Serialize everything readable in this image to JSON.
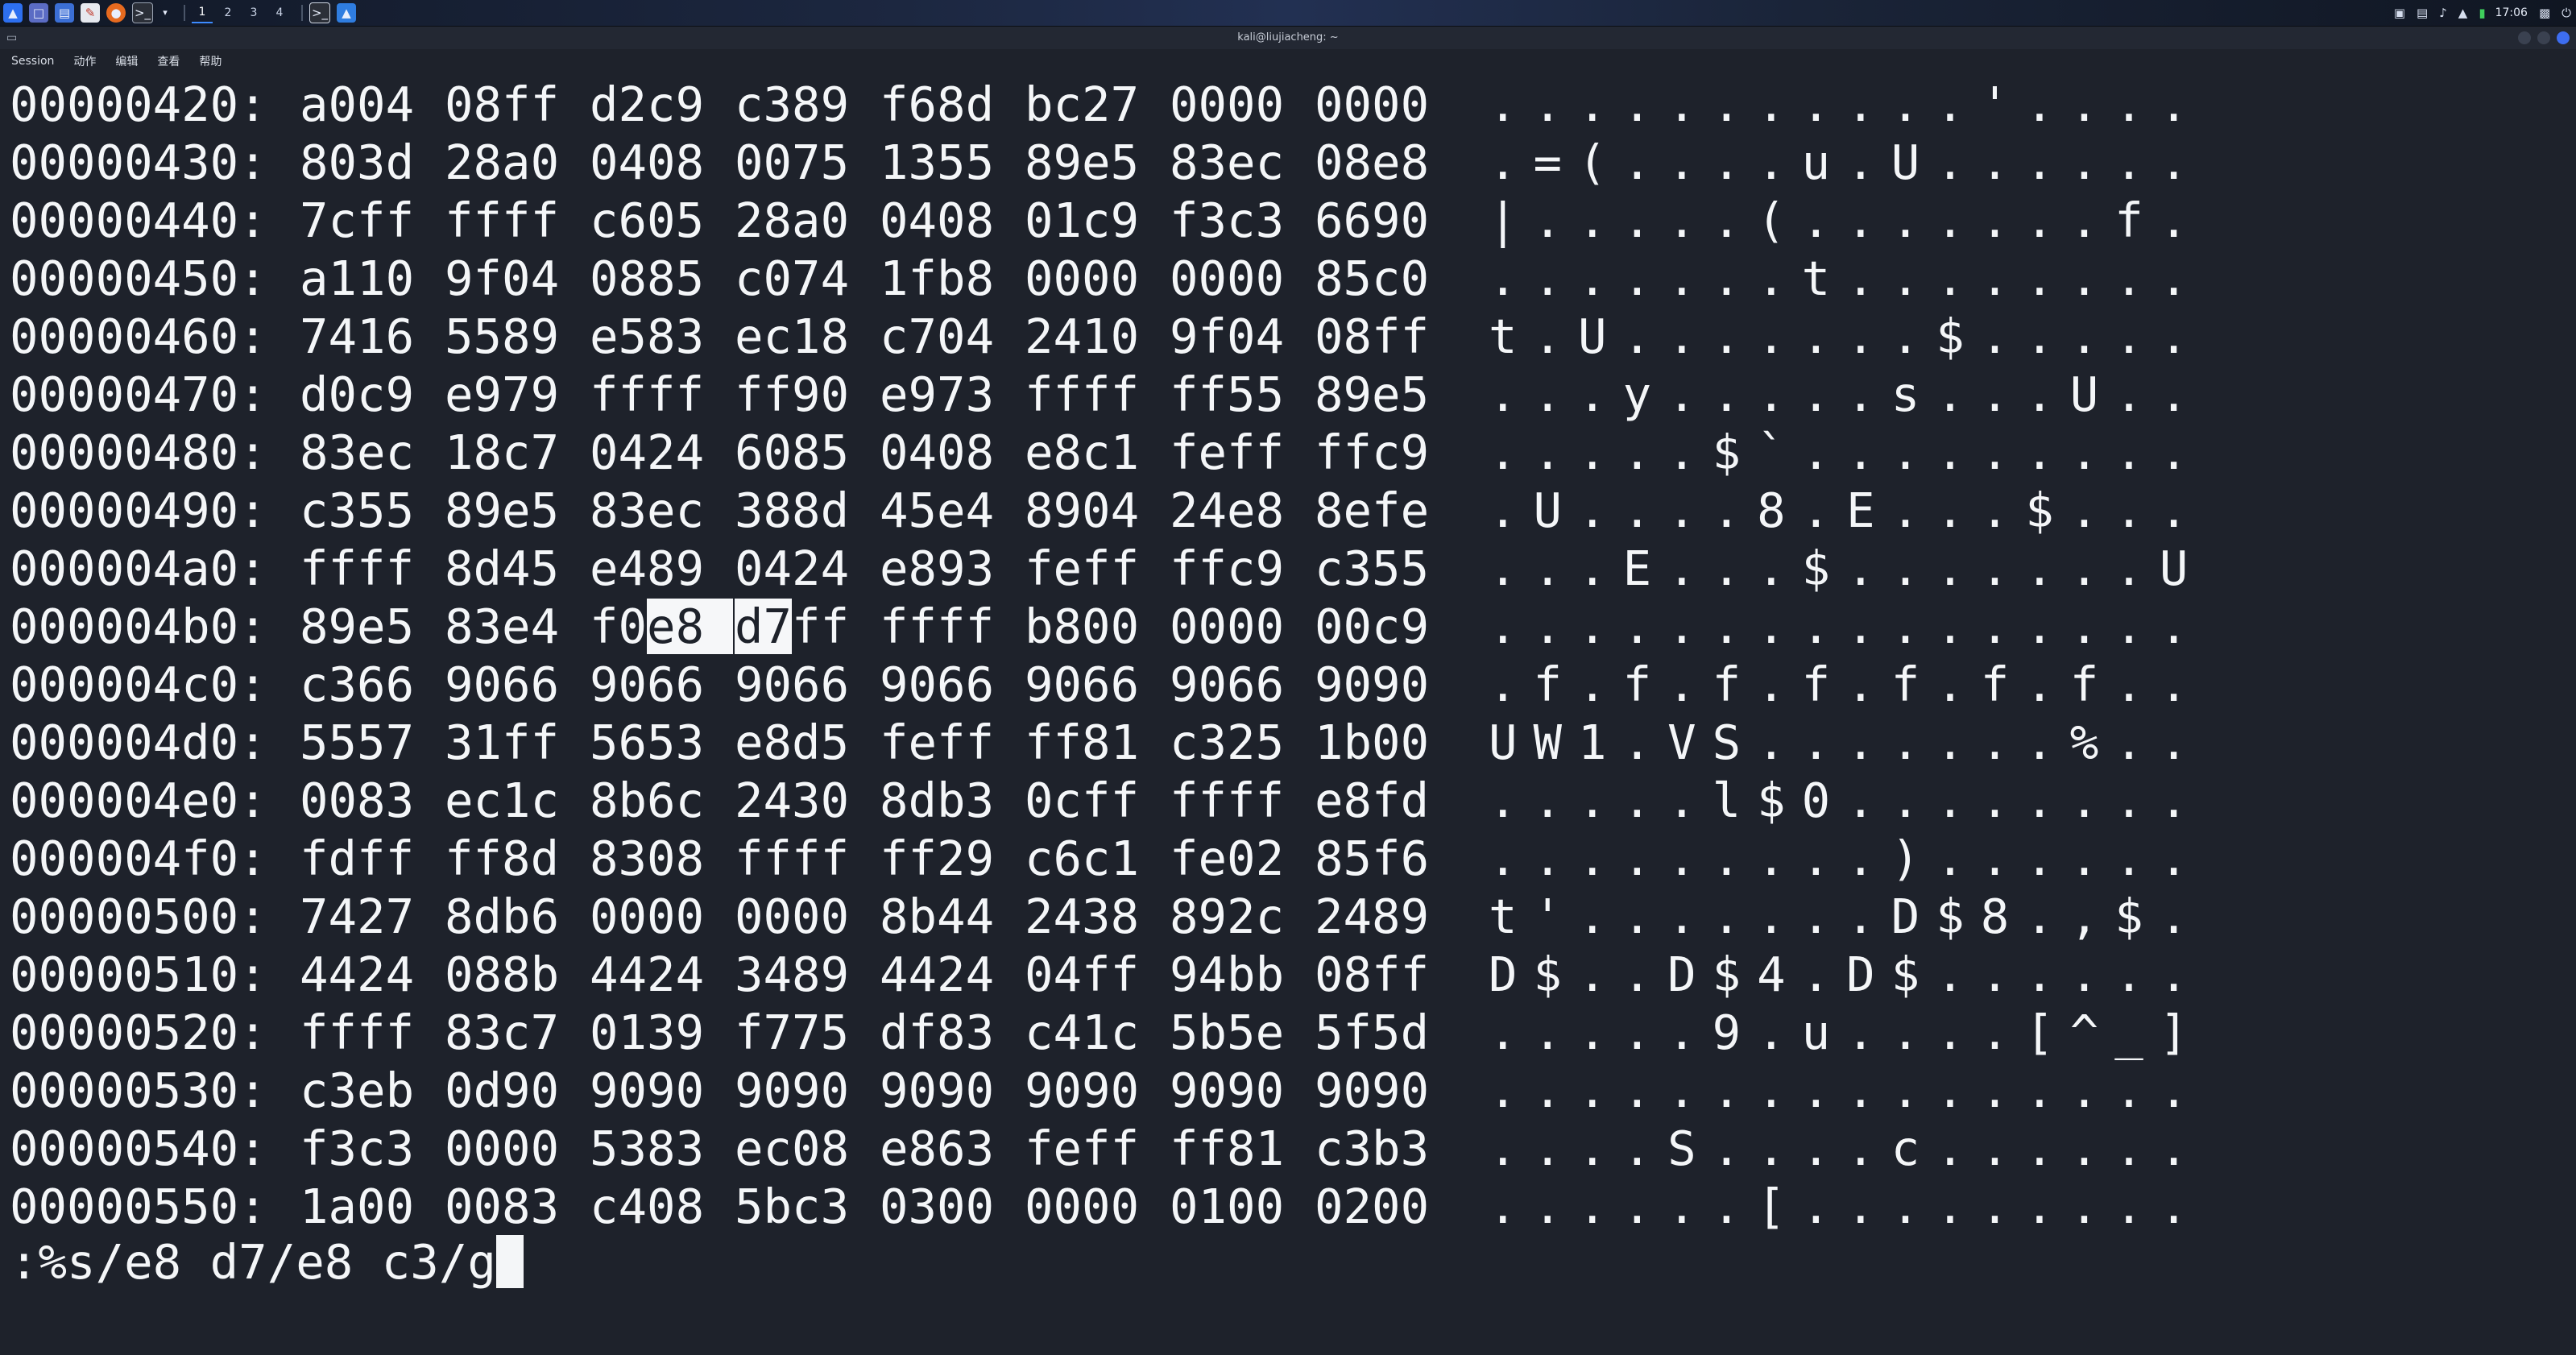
{
  "taskbar": {
    "workspaces": [
      "1",
      "2",
      "3",
      "4"
    ],
    "active_workspace": "1",
    "clock": "17:06",
    "accent": "#3d8bff"
  },
  "window": {
    "title": "kali@liujiacheng: ~"
  },
  "menu": {
    "items": [
      "Session",
      "动作",
      "编辑",
      "查看",
      "帮助"
    ]
  },
  "hexdump": {
    "rows": [
      {
        "addr": "00000420:",
        "groups": [
          "a004",
          "08ff",
          "d2c9",
          "c389",
          "f68d",
          "bc27",
          "0000",
          "0000"
        ],
        "ascii": "...........'...."
      },
      {
        "addr": "00000430:",
        "groups": [
          "803d",
          "28a0",
          "0408",
          "0075",
          "1355",
          "89e5",
          "83ec",
          "08e8"
        ],
        "ascii": ".=(....u.U......"
      },
      {
        "addr": "00000440:",
        "groups": [
          "7cff",
          "ffff",
          "c605",
          "28a0",
          "0408",
          "01c9",
          "f3c3",
          "6690"
        ],
        "ascii": "|.....(.......f."
      },
      {
        "addr": "00000450:",
        "groups": [
          "a110",
          "9f04",
          "0885",
          "c074",
          "1fb8",
          "0000",
          "0000",
          "85c0"
        ],
        "ascii": ".......t........"
      },
      {
        "addr": "00000460:",
        "groups": [
          "7416",
          "5589",
          "e583",
          "ec18",
          "c704",
          "2410",
          "9f04",
          "08ff"
        ],
        "ascii": "t.U.......$....."
      },
      {
        "addr": "00000470:",
        "groups": [
          "d0c9",
          "e979",
          "ffff",
          "ff90",
          "e973",
          "ffff",
          "ff55",
          "89e5"
        ],
        "ascii": "...y.....s...U.."
      },
      {
        "addr": "00000480:",
        "groups": [
          "83ec",
          "18c7",
          "0424",
          "6085",
          "0408",
          "e8c1",
          "feff",
          "ffc9"
        ],
        "ascii": ".....$`........."
      },
      {
        "addr": "00000490:",
        "groups": [
          "c355",
          "89e5",
          "83ec",
          "388d",
          "45e4",
          "8904",
          "24e8",
          "8efe"
        ],
        "ascii": ".U....8.E...$..."
      },
      {
        "addr": "000004a0:",
        "groups": [
          "ffff",
          "8d45",
          "e489",
          "0424",
          "e893",
          "feff",
          "ffc9",
          "c355"
        ],
        "ascii": "...E...$.......U"
      },
      {
        "addr": "000004b0:",
        "groups": [
          "89e5",
          "83e4",
          "f0e8",
          "d7ff",
          "ffff",
          "b800",
          "0000",
          "00c9"
        ],
        "ascii": "................"
      },
      {
        "addr": "000004c0:",
        "groups": [
          "c366",
          "9066",
          "9066",
          "9066",
          "9066",
          "9066",
          "9066",
          "9090"
        ],
        "ascii": ".f.f.f.f.f.f.f.."
      },
      {
        "addr": "000004d0:",
        "groups": [
          "5557",
          "31ff",
          "5653",
          "e8d5",
          "feff",
          "ff81",
          "c325",
          "1b00"
        ],
        "ascii": "UW1.VS.......%.."
      },
      {
        "addr": "000004e0:",
        "groups": [
          "0083",
          "ec1c",
          "8b6c",
          "2430",
          "8db3",
          "0cff",
          "ffff",
          "e8fd"
        ],
        "ascii": ".....l$0........"
      },
      {
        "addr": "000004f0:",
        "groups": [
          "fdff",
          "ff8d",
          "8308",
          "ffff",
          "ff29",
          "c6c1",
          "fe02",
          "85f6"
        ],
        "ascii": ".........)......"
      },
      {
        "addr": "00000500:",
        "groups": [
          "7427",
          "8db6",
          "0000",
          "0000",
          "8b44",
          "2438",
          "892c",
          "2489"
        ],
        "ascii": "t'.......D$8.,$."
      },
      {
        "addr": "00000510:",
        "groups": [
          "4424",
          "088b",
          "4424",
          "3489",
          "4424",
          "04ff",
          "94bb",
          "08ff"
        ],
        "ascii": "D$..D$4.D$......"
      },
      {
        "addr": "00000520:",
        "groups": [
          "ffff",
          "83c7",
          "0139",
          "f775",
          "df83",
          "c41c",
          "5b5e",
          "5f5d"
        ],
        "ascii": ".....9.u....[^_]"
      },
      {
        "addr": "00000530:",
        "groups": [
          "c3eb",
          "0d90",
          "9090",
          "9090",
          "9090",
          "9090",
          "9090",
          "9090"
        ],
        "ascii": "................"
      },
      {
        "addr": "00000540:",
        "groups": [
          "f3c3",
          "0000",
          "5383",
          "ec08",
          "e863",
          "feff",
          "ff81",
          "c3b3"
        ],
        "ascii": "....S....c......"
      },
      {
        "addr": "00000550:",
        "groups": [
          "1a00",
          "0083",
          "c408",
          "5bc3",
          "0300",
          "0000",
          "0100",
          "0200"
        ],
        "ascii": "......[........."
      }
    ],
    "highlight": {
      "row": 9,
      "text": "e8 d7"
    }
  },
  "command": ":%s/e8 d7/e8 c3/g",
  "colors": {
    "terminal_bg": "#1e222b",
    "terminal_fg": "#f4f6f8",
    "highlight_bg": "#f6f7f9"
  }
}
